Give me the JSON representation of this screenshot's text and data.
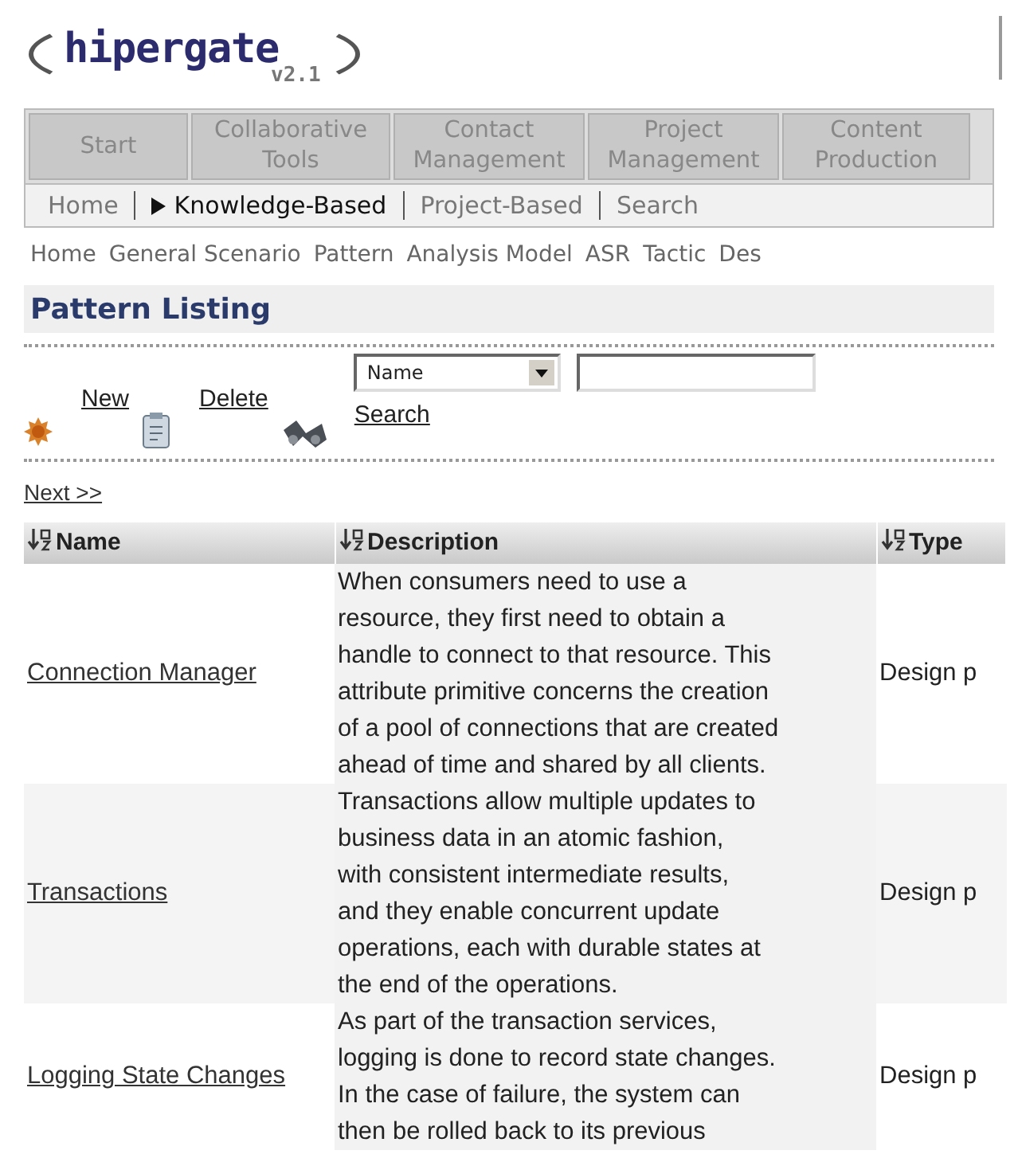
{
  "logo": {
    "name": "hipergate",
    "version": "v2.1"
  },
  "main_tabs": [
    {
      "label": "Start",
      "selected": false
    },
    {
      "label": "Collaborative Tools",
      "selected": false
    },
    {
      "label": "Contact Management",
      "selected": false
    },
    {
      "label": "Project Management",
      "selected": false
    },
    {
      "label": "Content Production",
      "selected": false
    }
  ],
  "sub_nav": [
    {
      "label": "Home",
      "selected": false
    },
    {
      "label": "Knowledge-Based",
      "selected": true
    },
    {
      "label": "Project-Based",
      "selected": false
    },
    {
      "label": "Search",
      "selected": false
    }
  ],
  "section_nav": [
    "Home",
    "General Scenario",
    "Pattern",
    "Analysis Model",
    "ASR",
    "Tactic",
    "Des"
  ],
  "page_title": "Pattern Listing",
  "toolbar": {
    "new": "New",
    "delete": "Delete",
    "search_by": "Name",
    "search": "Search"
  },
  "pager": {
    "next": "Next >>"
  },
  "table": {
    "columns": [
      "Name",
      "Description",
      "Type"
    ],
    "rows": [
      {
        "name": "Connection Manager",
        "description": [
          "When consumers need to use a",
          "resource, they first need to obtain a",
          "handle to connect to that resource. This",
          "attribute primitive concerns the creation",
          "of a pool of connections that are created",
          "ahead of time and shared by all clients."
        ],
        "type": "Design p"
      },
      {
        "name": "Transactions",
        "description": [
          "Transactions allow multiple updates to",
          "business data in an atomic fashion,",
          "with consistent intermediate results,",
          "and they enable concurrent update",
          "operations, each with durable states at",
          "the end of the operations."
        ],
        "type": "Design p"
      },
      {
        "name": "Logging State Changes",
        "description": [
          "As part of the transaction services,",
          "logging is done to record state changes.",
          "In the case of failure, the system can",
          "then be rolled back to its previous"
        ],
        "type": "Design p"
      }
    ]
  }
}
